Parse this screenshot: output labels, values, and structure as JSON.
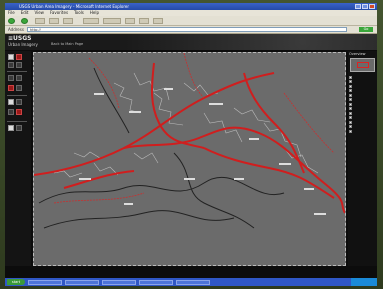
{
  "browser": {
    "title": "USGS Urban Area Imagery - Microsoft Internet Explorer",
    "menu": [
      "File",
      "Edit",
      "View",
      "Favorites",
      "Tools",
      "Help"
    ],
    "address_label": "Address",
    "address_value": "http://",
    "go_label": "Go"
  },
  "page": {
    "logo": "≡USGS",
    "subtitle": "Urban Imagery",
    "home_link": "Back to Main Page",
    "map_title": "",
    "right_panel_title": "Overview",
    "layers": [
      "",
      "",
      "",
      "",
      "",
      "",
      "",
      "",
      "",
      "",
      "",
      "",
      ""
    ],
    "footer_items": [
      "",
      "",
      "",
      ""
    ]
  },
  "taskbar": {
    "start": "start",
    "tasks": [
      "",
      "",
      "",
      "",
      ""
    ],
    "clock": ""
  },
  "colors": {
    "map_bg": "#6b6b6b",
    "road_red": "#d01e1e",
    "accent_blue": "#2f57c6"
  }
}
